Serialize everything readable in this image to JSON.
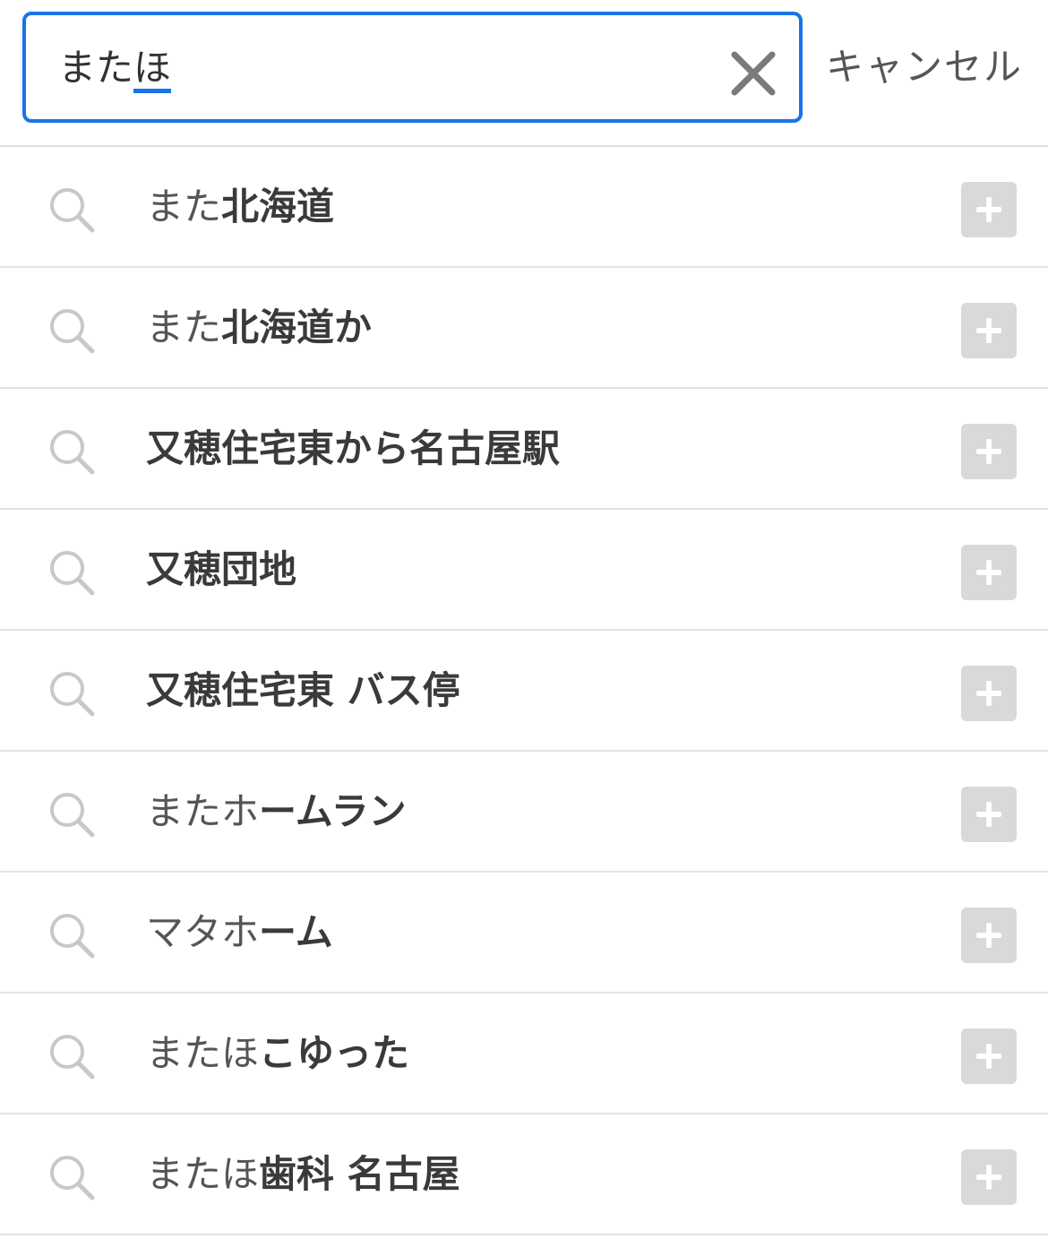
{
  "search": {
    "committed_text": "また",
    "composing_text": "ほ",
    "clear_icon": "close-icon",
    "cancel_label": "キャンセル"
  },
  "suggestions": [
    {
      "typed": "また",
      "completion": "北海道"
    },
    {
      "typed": "また",
      "completion": "北海道か"
    },
    {
      "typed": "",
      "completion": "又穂住宅東から名古屋駅"
    },
    {
      "typed": "",
      "completion": "又穂団地"
    },
    {
      "typed": "",
      "completion": "又穂住宅東 バス停"
    },
    {
      "typed": "またホ",
      "completion": "ームラン"
    },
    {
      "typed": "マタホ",
      "completion": "ーム"
    },
    {
      "typed": "またほ",
      "completion": "こゆった"
    },
    {
      "typed": "またほ",
      "completion": "歯科 名古屋"
    }
  ],
  "icons": {
    "row_leading": "search-icon",
    "row_trailing": "plus-icon"
  },
  "colors": {
    "accent": "#1a73e8",
    "append_button_bg": "#d9d9d9",
    "icon_gray": "#c8c8c8",
    "clear_icon_gray": "#7a7a7a"
  }
}
